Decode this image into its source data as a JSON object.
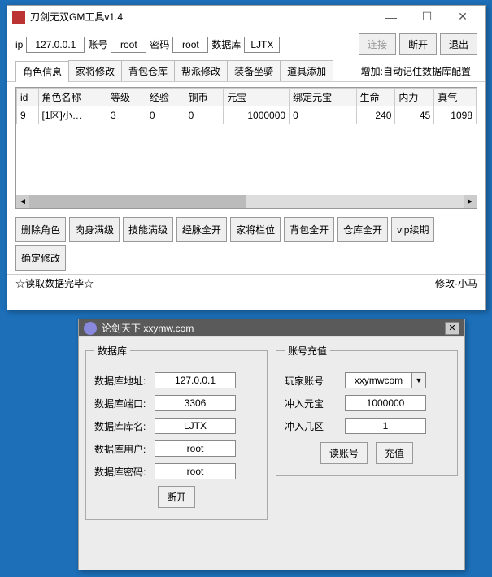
{
  "win1": {
    "title": "刀剑无双GM工具v1.4",
    "conn": {
      "ip_label": "ip",
      "ip": "127.0.0.1",
      "acc_label": "账号",
      "acc": "root",
      "pwd_label": "密码",
      "pwd": "root",
      "db_label": "数据库",
      "db": "LJTX",
      "connect": "连接",
      "disconnect": "断开",
      "exit": "退出"
    },
    "tabs": [
      "角色信息",
      "家将修改",
      "背包仓库",
      "帮派修改",
      "装备坐骑",
      "道具添加"
    ],
    "tabs_extra": "增加:自动记住数据库配置",
    "grid": {
      "headers": [
        "id",
        "角色名称",
        "等级",
        "经验",
        "铜币",
        "元宝",
        "绑定元宝",
        "生命",
        "内力",
        "真气"
      ],
      "rows": [
        [
          "9",
          "[1区]小…",
          "3",
          "0",
          "0",
          "1000000",
          "0",
          "240",
          "45",
          "1098"
        ]
      ]
    },
    "actions": [
      "删除角色",
      "肉身满级",
      "技能满级",
      "经脉全开",
      "家将栏位",
      "背包全开",
      "仓库全开",
      "vip续期",
      "确定修改"
    ],
    "status_left": "☆读取数据完毕☆",
    "status_right": "修改·小马"
  },
  "win2": {
    "title": "论剑天下  xxymw.com",
    "db": {
      "legend": "数据库",
      "addr_label": "数据库地址:",
      "addr": "127.0.0.1",
      "port_label": "数据库端口:",
      "port": "3306",
      "name_label": "数据库库名:",
      "name": "LJTX",
      "user_label": "数据库用户:",
      "user": "root",
      "pwd_label": "数据库密码:",
      "pwd": "root",
      "disconnect": "断开"
    },
    "recharge": {
      "legend": "账号充值",
      "player_label": "玩家账号",
      "player": "xxymwcom",
      "gold_label": "冲入元宝",
      "gold": "1000000",
      "zone_label": "冲入几区",
      "zone": "1",
      "read": "读账号",
      "charge": "充值"
    }
  }
}
